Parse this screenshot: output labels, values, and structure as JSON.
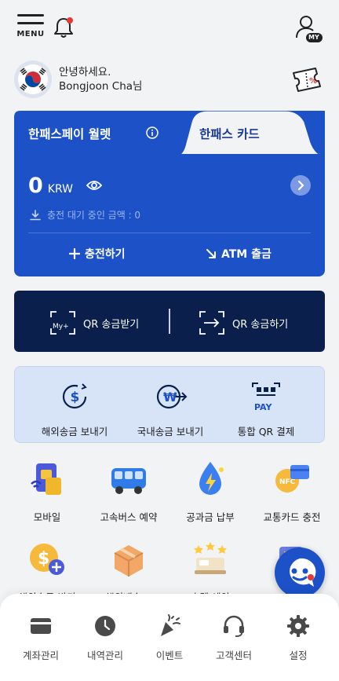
{
  "header": {
    "menu_label": "MENU",
    "my_label": "MY"
  },
  "greeting": {
    "hello": "안녕하세요.",
    "name": "Bongjoon Cha님"
  },
  "wallet": {
    "tab_wallet": "한패스페이 월렛",
    "tab_card": "한패스 카드",
    "balance": "0",
    "currency": "KRW",
    "pending": "충전 대기 중인 금액 : 0",
    "charge_label": "충전하기",
    "atm_label": "ATM 출금"
  },
  "qr": {
    "receive_label": "QR 송금받기",
    "send_label": "QR 송금하기",
    "icon_text": "My+"
  },
  "remit": {
    "overseas_label": "해외송금 보내기",
    "domestic_label": "국내송금 보내기",
    "qr_pay_label": "통합 QR 결제",
    "pay_text": "PAY"
  },
  "services": [
    {
      "label": "모바일"
    },
    {
      "label": "고속버스 예약"
    },
    {
      "label": "공과금 납부"
    },
    {
      "label": "교통카드 충전"
    },
    {
      "label": "해외송금 받기"
    },
    {
      "label": "해외배송 &"
    },
    {
      "label": "호텔 예약"
    },
    {
      "label": "한국"
    }
  ],
  "nav": [
    {
      "label": "계좌관리"
    },
    {
      "label": "내역관리"
    },
    {
      "label": "이벤트"
    },
    {
      "label": "고객센터"
    },
    {
      "label": "설정"
    }
  ],
  "colors": {
    "brand_blue": "#1c51c8",
    "navy": "#0b1f4d",
    "light_blue": "#d7e4f8",
    "notification_red": "#e53935"
  }
}
